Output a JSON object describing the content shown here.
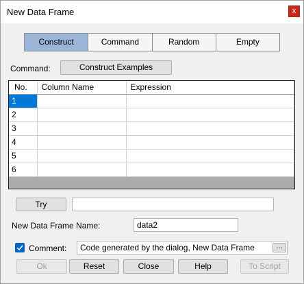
{
  "window": {
    "title": "New Data Frame",
    "close_glyph": "x"
  },
  "tabs": [
    {
      "label": "Construct",
      "active": true
    },
    {
      "label": "Command",
      "active": false
    },
    {
      "label": "Random",
      "active": false
    },
    {
      "label": "Empty",
      "active": false
    }
  ],
  "command": {
    "label": "Command:",
    "button_label": "Construct Examples"
  },
  "grid": {
    "columns": [
      "No.",
      "Column Name",
      "Expression"
    ],
    "rows": [
      {
        "no": "1",
        "column_name": "",
        "expression": ""
      },
      {
        "no": "2",
        "column_name": "",
        "expression": ""
      },
      {
        "no": "3",
        "column_name": "",
        "expression": ""
      },
      {
        "no": "4",
        "column_name": "",
        "expression": ""
      },
      {
        "no": "5",
        "column_name": "",
        "expression": ""
      },
      {
        "no": "6",
        "column_name": "",
        "expression": ""
      }
    ]
  },
  "try": {
    "button_label": "Try",
    "output": ""
  },
  "name": {
    "label": "New Data Frame Name:",
    "value": "data2"
  },
  "comment": {
    "checked": true,
    "label": "Comment:",
    "value": "Code generated by the dialog, New Data Frame",
    "browse_label": "..."
  },
  "footer": {
    "ok": "Ok",
    "reset": "Reset",
    "close": "Close",
    "help": "Help",
    "to_script": "To Script"
  },
  "colors": {
    "accent": "#0078d7",
    "active_tab": "#9ab5d7",
    "close": "#c42b1c"
  }
}
